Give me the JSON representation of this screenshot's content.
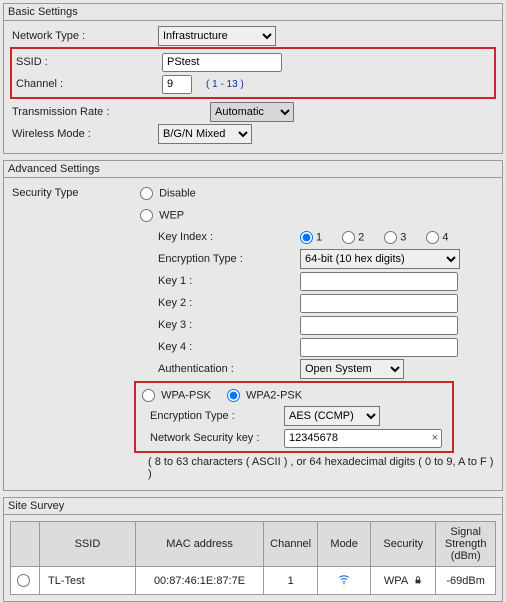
{
  "basic": {
    "title": "Basic Settings",
    "network_type_label": "Network Type :",
    "network_type_value": "Infrastructure",
    "ssid_label": "SSID :",
    "ssid_value": "PStest",
    "channel_label": "Channel :",
    "channel_value": "9",
    "channel_range": "( 1 - 13 )",
    "tx_rate_label": "Transmission Rate :",
    "tx_rate_value": "Automatic",
    "wireless_mode_label": "Wireless Mode :",
    "wireless_mode_value": "B/G/N Mixed"
  },
  "advanced": {
    "title": "Advanced Settings",
    "security_type_label": "Security Type",
    "disable_label": "Disable",
    "wep_label": "WEP",
    "key_index_label": "Key Index :",
    "key_index_options": [
      "1",
      "2",
      "3",
      "4"
    ],
    "key_index_selected": "1",
    "enc_type_label": "Encryption Type :",
    "enc_type_value": "64-bit (10 hex digits)",
    "key1_label": "Key 1 :",
    "key2_label": "Key 2 :",
    "key3_label": "Key 3 :",
    "key4_label": "Key 4 :",
    "key1_value": "",
    "key2_value": "",
    "key3_value": "",
    "key4_value": "",
    "auth_label": "Authentication :",
    "auth_value": "Open System",
    "wpa_psk_label": "WPA-PSK",
    "wpa2_psk_label": "WPA2-PSK",
    "psk_enc_label": "Encryption Type :",
    "psk_enc_value": "AES (CCMP)",
    "net_key_label": "Network Security key :",
    "net_key_value": "12345678",
    "key_hint": "( 8 to 63 characters ( ASCII ) , or 64 hexadecimal digits ( 0 to 9, A to F ) )"
  },
  "survey": {
    "title": "Site Survey",
    "headers": {
      "sel": "",
      "ssid": "SSID",
      "mac": "MAC address",
      "channel": "Channel",
      "mode": "Mode",
      "security": "Security",
      "signal": "Signal Strength (dBm)"
    },
    "rows": [
      {
        "ssid": "TL-Test",
        "mac": "00:87:46:1E:87:7E",
        "channel": "1",
        "mode_icon": "wifi",
        "security": "WPA",
        "signal": "-69dBm"
      }
    ]
  }
}
